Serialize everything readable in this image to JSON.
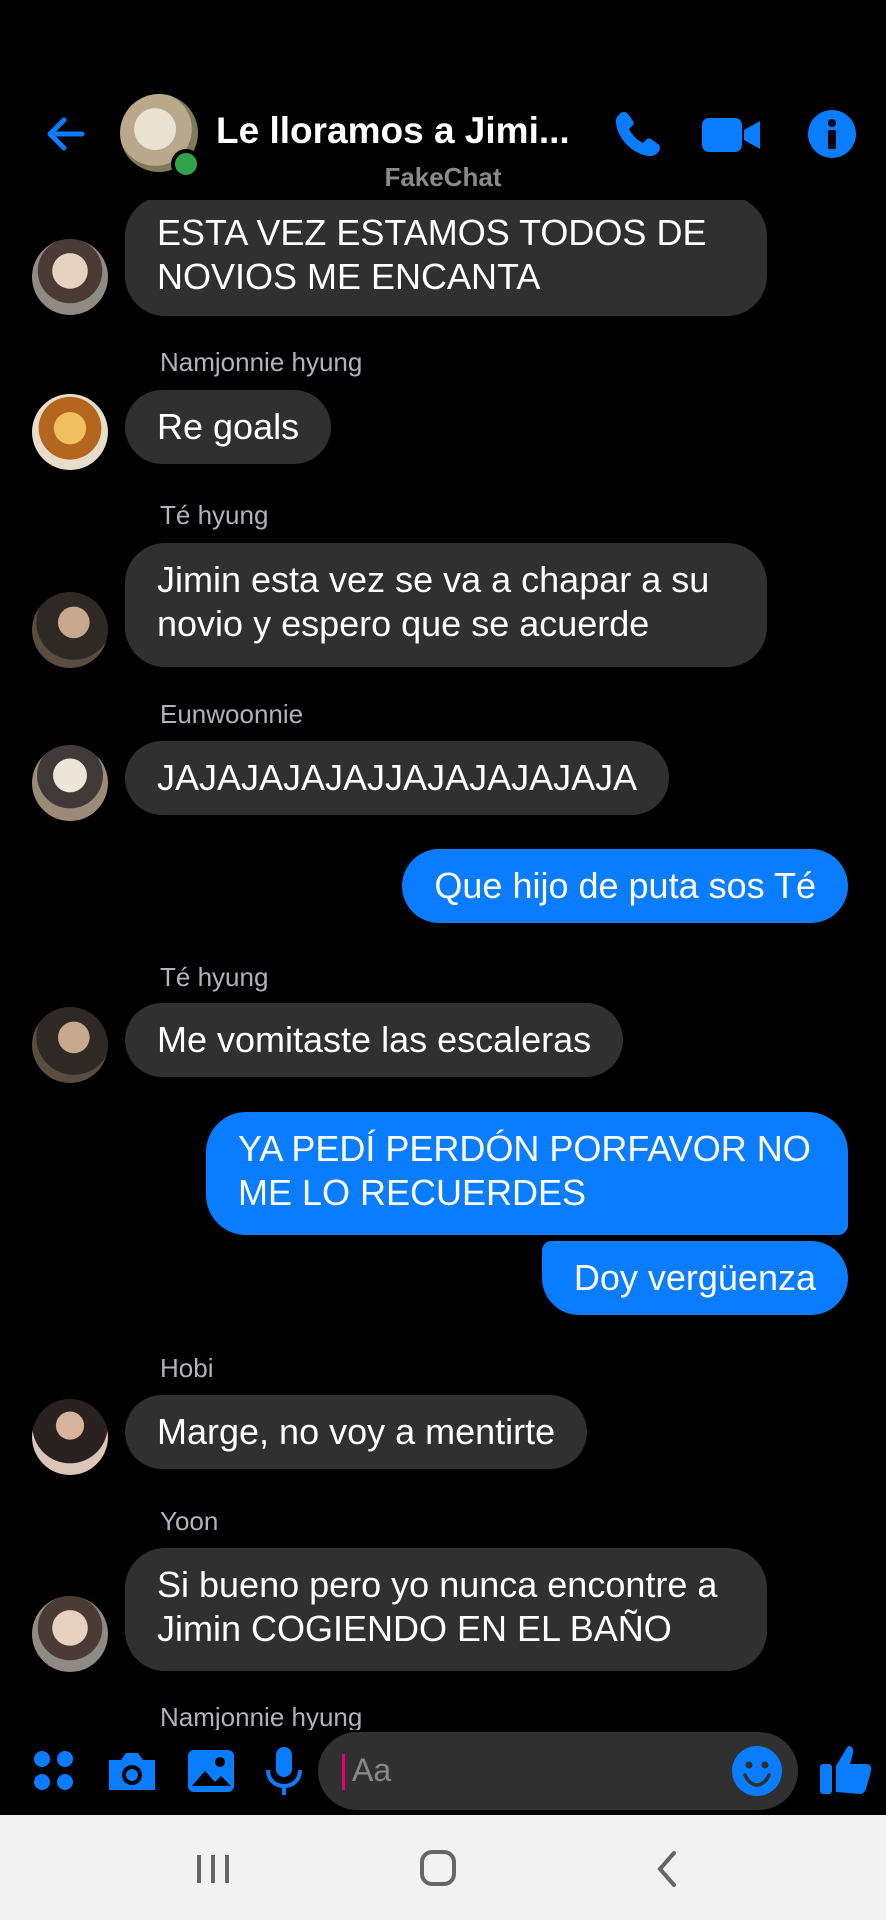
{
  "header": {
    "title": "Le lloramos a Jimi...",
    "watermark": "FakeChat",
    "accent_color": "#0a7cff",
    "icons": [
      "back-arrow-icon",
      "group-avatar",
      "online-dot",
      "phone-icon",
      "video-camera-icon",
      "info-icon"
    ]
  },
  "messages": [
    {
      "direction": "in",
      "avatar": "yoon-avatar",
      "text": "ESTA VEZ ESTAMOS TODOS  DE\nNOVIOS ME ENCANTA"
    },
    {
      "direction": "in",
      "sender": "Namjonnie hyung",
      "avatar": "namjonnie-avatar",
      "text": "Re goals"
    },
    {
      "direction": "in",
      "sender": "Té hyung",
      "avatar": "te-avatar",
      "text": "Jimin esta vez se va a chapar a su\nnovio y espero que se acuerde"
    },
    {
      "direction": "in",
      "sender": "Eunwoonnie",
      "avatar": "eunwoonnie-avatar",
      "text": "JAJAJAJAJAJJAJAJAJAJAJA"
    },
    {
      "direction": "out",
      "text": "Que hijo de puta sos Té"
    },
    {
      "direction": "in",
      "sender": "Té hyung",
      "avatar": "te-avatar",
      "text": "Me vomitaste las escaleras"
    },
    {
      "direction": "out",
      "text": "YA PEDÍ PERDÓN PORFAVOR NO\nME LO RECUERDES"
    },
    {
      "direction": "out",
      "text": "Doy vergüenza"
    },
    {
      "direction": "in",
      "sender": "Hobi",
      "avatar": "hobi-avatar",
      "text": "Marge, no voy a mentirte"
    },
    {
      "direction": "in",
      "sender": "Yoon",
      "avatar": "yoon-avatar",
      "text": "Si bueno pero yo nunca encontre a\nJimin COGIENDO EN EL BAÑO"
    },
    {
      "direction": "in",
      "sender": "Namjonnie hyung"
    }
  ],
  "composer": {
    "placeholder": "Aa",
    "icons": [
      "apps-icon",
      "camera-icon",
      "gallery-icon",
      "microphone-icon",
      "emoji-icon",
      "thumbs-up-icon"
    ]
  },
  "system_nav": {
    "icons": [
      "recent-apps-icon",
      "home-icon",
      "back-icon"
    ]
  }
}
